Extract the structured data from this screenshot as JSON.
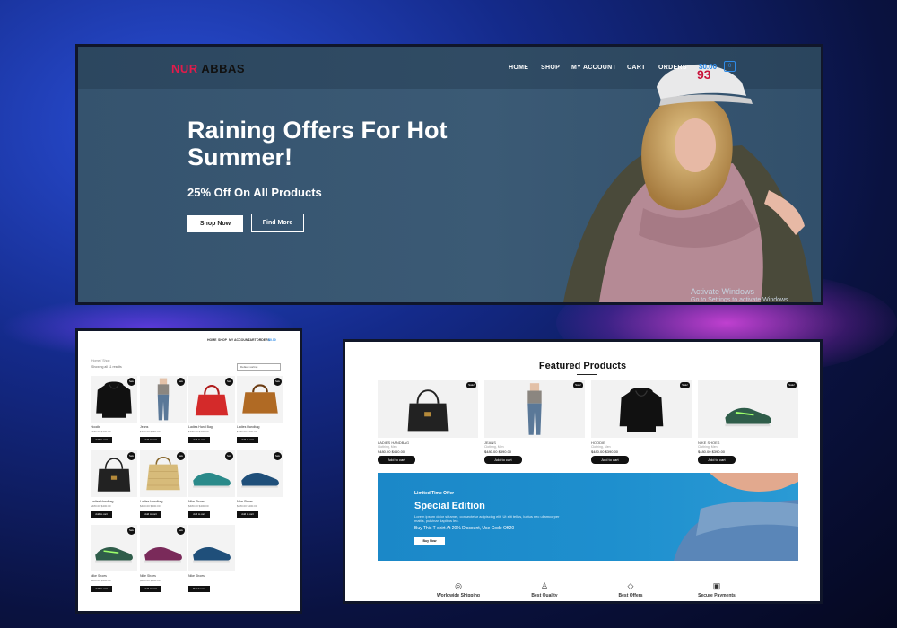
{
  "hero": {
    "logo_part1": "NUR",
    "logo_part2": "ABBAS",
    "nav": [
      "HOME",
      "SHOP",
      "MY ACCOUNT",
      "CART",
      "ORDERS"
    ],
    "cart_total": "$0.00",
    "cart_count": "0",
    "title": "Raining Offers For Hot Summer!",
    "subtitle": "25% Off On All Products",
    "btn_shop": "Shop Now",
    "btn_find": "Find More",
    "activate_line1": "Activate Windows",
    "activate_line2": "Go to Settings to activate Windows."
  },
  "shop": {
    "nav": [
      "HOME",
      "SHOP",
      "MY ACCOUNT",
      "CART",
      "ORDERS",
      "$0.00"
    ],
    "breadcrumb": "Home / Shop",
    "showing": "Showing all 11 results",
    "sort": "Default sorting",
    "sale_badge": "Sale",
    "add_label": "Add to cart",
    "read_label": "Read more",
    "items": [
      {
        "name": "Hoodie",
        "price": "$480.00 $400.00",
        "img": "hoodie"
      },
      {
        "name": "Jeans",
        "price": "$480.00 $350.00",
        "img": "jeans"
      },
      {
        "name": "Ladies Hand Bag",
        "price": "$480.00 $400.00",
        "img": "redbag"
      },
      {
        "name": "Ladies Handbag",
        "price": "$480.00 $400.00",
        "img": "brownbag"
      },
      {
        "name": "Ladies Handbag",
        "price": "$480.00 $400.00",
        "img": "blackbag"
      },
      {
        "name": "Ladies Handbag",
        "price": "$480.00 $400.00",
        "img": "goldbag"
      },
      {
        "name": "Nike Shoes",
        "price": "$480.00 $400.00",
        "img": "shoe-teal"
      },
      {
        "name": "Nike Shoes",
        "price": "$480.00 $400.00",
        "img": "shoe-blue"
      },
      {
        "name": "Nike Shoes",
        "price": "$480.00 $400.00",
        "img": "shoe-green"
      },
      {
        "name": "Nike Shoes",
        "price": "$480.00 $400.00",
        "img": "shoe-pink"
      },
      {
        "name": "Nike Shoes",
        "price": "",
        "img": "shoe-blue"
      }
    ]
  },
  "featured": {
    "title": "Featured Products",
    "badge": "Sale!",
    "add_label": "Add to cart",
    "products": [
      {
        "name": "LADIES HANDBAG",
        "category": "Clothing, Men",
        "price": "$480.00 $460.00",
        "img": "blackbag"
      },
      {
        "name": "JEANS",
        "category": "Clothing, Men",
        "price": "$480.00 $390.00",
        "img": "jeans"
      },
      {
        "name": "HOODIE",
        "category": "Clothing, Men",
        "price": "$480.00 $390.00",
        "img": "hoodie"
      },
      {
        "name": "NIKE SHOES",
        "category": "Clothing, Men",
        "price": "$480.00 $390.00",
        "img": "shoe-green"
      }
    ],
    "banner": {
      "small": "Limited Time Offer",
      "title": "Special Edition",
      "text": "Lorem ipsum dolor sit amet, consectetur adipiscing elit. Ut elit tellus, luctus nec ullamcorper mattis, pulvinar dapibus leo.",
      "text2": "Buy This T-shirt At 20% Discount, Use Code Off20",
      "button": "Buy Now"
    },
    "features": [
      {
        "label": "Worldwide Shipping",
        "icon": "globe-icon"
      },
      {
        "label": "Best Quality",
        "icon": "shirt-icon"
      },
      {
        "label": "Best Offers",
        "icon": "tag-icon"
      },
      {
        "label": "Secure Payments",
        "icon": "lock-icon"
      }
    ]
  }
}
